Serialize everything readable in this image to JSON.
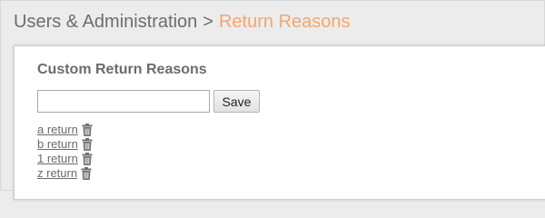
{
  "breadcrumb": {
    "parent": "Users & Administration",
    "separator": ">",
    "current": "Return Reasons"
  },
  "panel": {
    "title": "Custom Return Reasons",
    "input_value": "",
    "save_label": "Save"
  },
  "reasons": [
    {
      "label": "a return"
    },
    {
      "label": "b return"
    },
    {
      "label": "1 return"
    },
    {
      "label": "z return"
    }
  ],
  "colors": {
    "accent": "#f5a66a",
    "text": "#6b6b6b",
    "background": "#ececec"
  },
  "icons": {
    "delete": "trash-icon"
  }
}
